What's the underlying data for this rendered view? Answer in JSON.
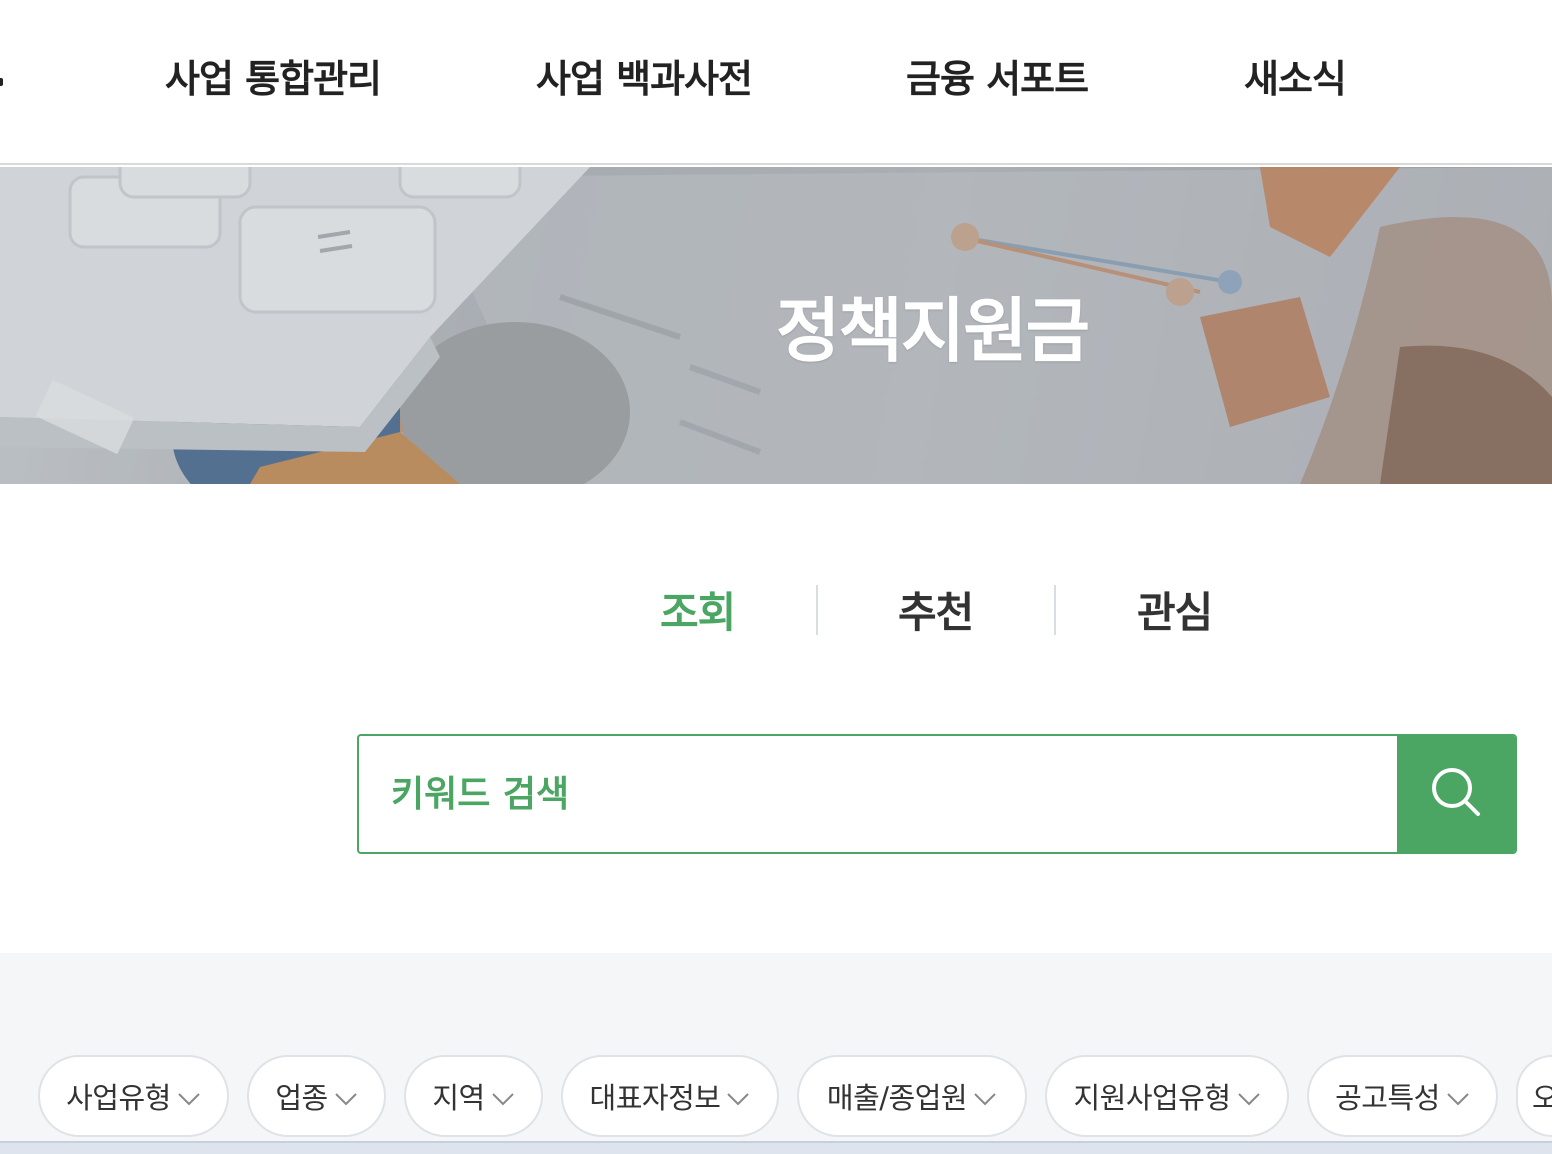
{
  "nav": {
    "items": [
      "사업 통합관리",
      "사업 백과사전",
      "금융 서포트",
      "새소식"
    ]
  },
  "hero": {
    "title": "정책지원금"
  },
  "tabs": {
    "items": [
      "조회",
      "추천",
      "관심"
    ],
    "active": "조회"
  },
  "search": {
    "placeholder": "키워드 검색"
  },
  "filters": {
    "chips": [
      "사업유형",
      "업종",
      "지역",
      "대표자정보",
      "매출/종업원",
      "지원사업유형",
      "공고특성",
      "오"
    ]
  },
  "colors": {
    "accent": "#4ca663",
    "filter_bg": "#f5f6f8",
    "chip_border": "#dfe2e6"
  },
  "icons": [
    "search-icon",
    "chevron-down-icon"
  ]
}
